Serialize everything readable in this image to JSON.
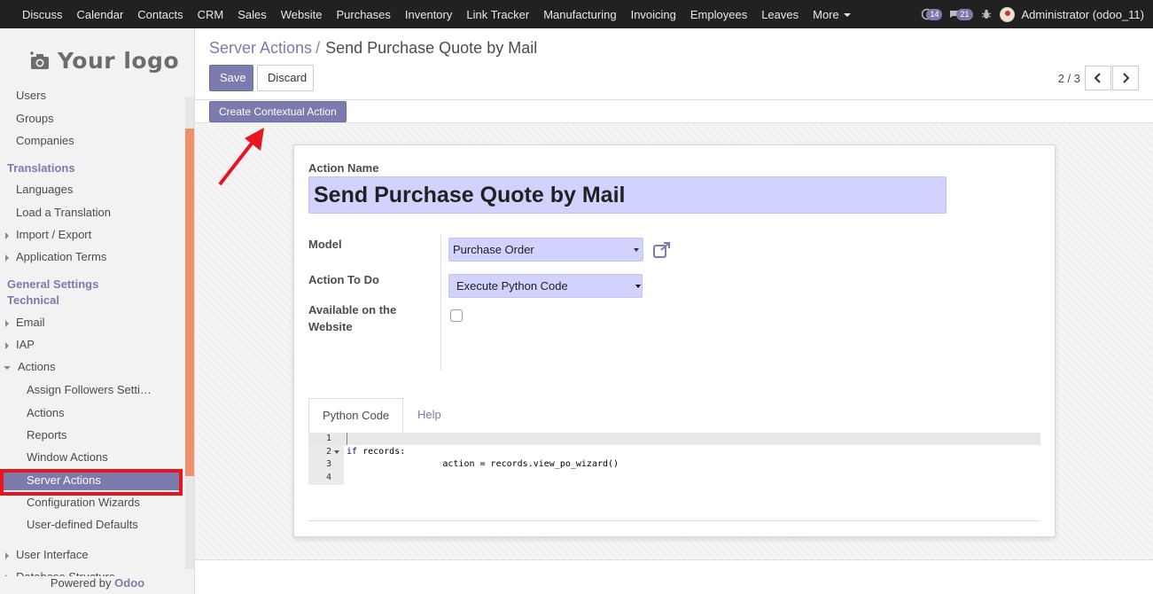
{
  "topnav": {
    "apps": [
      "Discuss",
      "Calendar",
      "Contacts",
      "CRM",
      "Sales",
      "Website",
      "Purchases",
      "Inventory",
      "Link Tracker",
      "Manufacturing",
      "Invoicing",
      "Employees",
      "Leaves"
    ],
    "more_label": "More",
    "activity_count": "14",
    "message_count": "21",
    "user_label": "Administrator (odoo_11)"
  },
  "sidebar": {
    "logo_text": "Your logo",
    "items": {
      "users": "Users",
      "groups": "Groups",
      "companies": "Companies",
      "translations": "Translations",
      "languages": "Languages",
      "load_translation": "Load a Translation",
      "import_export": "Import / Export",
      "application_terms": "Application Terms",
      "general_settings": "General Settings",
      "technical": "Technical",
      "email": "Email",
      "iap": "IAP",
      "actions": "Actions",
      "assign_followers": "Assign Followers Setti…",
      "actions_sub": "Actions",
      "reports": "Reports",
      "window_actions": "Window Actions",
      "server_actions": "Server Actions",
      "config_wizards": "Configuration Wizards",
      "user_defaults": "User-defined Defaults",
      "user_interface": "User Interface",
      "database_structure": "Database Structure"
    },
    "powered_prefix": "Powered by",
    "powered_brand": "Odoo"
  },
  "control": {
    "breadcrumb_parent": "Server Actions",
    "breadcrumb_sep": "/",
    "breadcrumb_current": "Send Purchase Quote by Mail",
    "save_label": "Save",
    "discard_label": "Discard",
    "pager": "2 / 3"
  },
  "statusbar": {
    "contextual_label": "Create Contextual Action"
  },
  "form": {
    "action_name_label": "Action Name",
    "action_name_value": "Send Purchase Quote by Mail",
    "model_label": "Model",
    "model_value": "Purchase Order",
    "action_todo_label": "Action To Do",
    "action_todo_value": "Execute Python Code",
    "website_label_1": "Available on the",
    "website_label_2": "Website",
    "website_checked": false
  },
  "tabs": {
    "python_code": "Python Code",
    "help": "Help"
  },
  "code": {
    "lines": [
      {
        "n": "1",
        "text": ""
      },
      {
        "n": "2",
        "kw": "if",
        "text": " records:"
      },
      {
        "n": "3",
        "text": "                  action = records.view_po_wizard()"
      },
      {
        "n": "4",
        "text": ""
      }
    ]
  },
  "colors": {
    "brand": "#7c7bad",
    "navbar": "#212121",
    "required_field": "#d2d2ff",
    "annotation": "#e8141e",
    "scroll_thumb": "#f0906b"
  }
}
